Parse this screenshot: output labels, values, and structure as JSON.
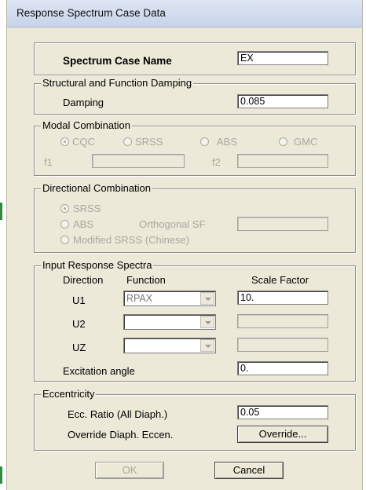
{
  "window": {
    "title": "Response Spectrum Case Data"
  },
  "spectrum_case": {
    "label": "Spectrum Case Name",
    "value": "EX"
  },
  "damping": {
    "group": "Structural and Function Damping",
    "label": "Damping",
    "value": "0.085"
  },
  "modal": {
    "group": "Modal Combination",
    "options": [
      "CQC",
      "SRSS",
      "ABS",
      "GMC"
    ],
    "selected": "CQC",
    "f1_label": "f1",
    "f1_value": "",
    "f2_label": "f2",
    "f2_value": ""
  },
  "directional": {
    "group": "Directional Combination",
    "options": [
      "SRSS",
      "ABS",
      "Modified SRSS (Chinese)"
    ],
    "selected": "SRSS",
    "orth_label": "Orthogonal SF",
    "orth_value": ""
  },
  "input_spectra": {
    "group": "Input Response Spectra",
    "col_direction": "Direction",
    "col_function": "Function",
    "col_scale": "Scale Factor",
    "rows": [
      {
        "dir": "U1",
        "function": "RPAX",
        "scale": "10."
      },
      {
        "dir": "U2",
        "function": "",
        "scale": ""
      },
      {
        "dir": "UZ",
        "function": "",
        "scale": ""
      }
    ],
    "excitation_label": "Excitation angle",
    "excitation_value": "0."
  },
  "eccentricity": {
    "group": "Eccentricity",
    "ratio_label": "Ecc. Ratio (All Diaph.)",
    "ratio_value": "0.05",
    "override_label": "Override Diaph. Eccen.",
    "override_button": "Override..."
  },
  "buttons": {
    "ok": "OK",
    "cancel": "Cancel"
  },
  "colors": {
    "dialog_bg": "#ece9d8",
    "titlebar": "#c6d3e9",
    "disabled_text": "#a9a8a0"
  }
}
